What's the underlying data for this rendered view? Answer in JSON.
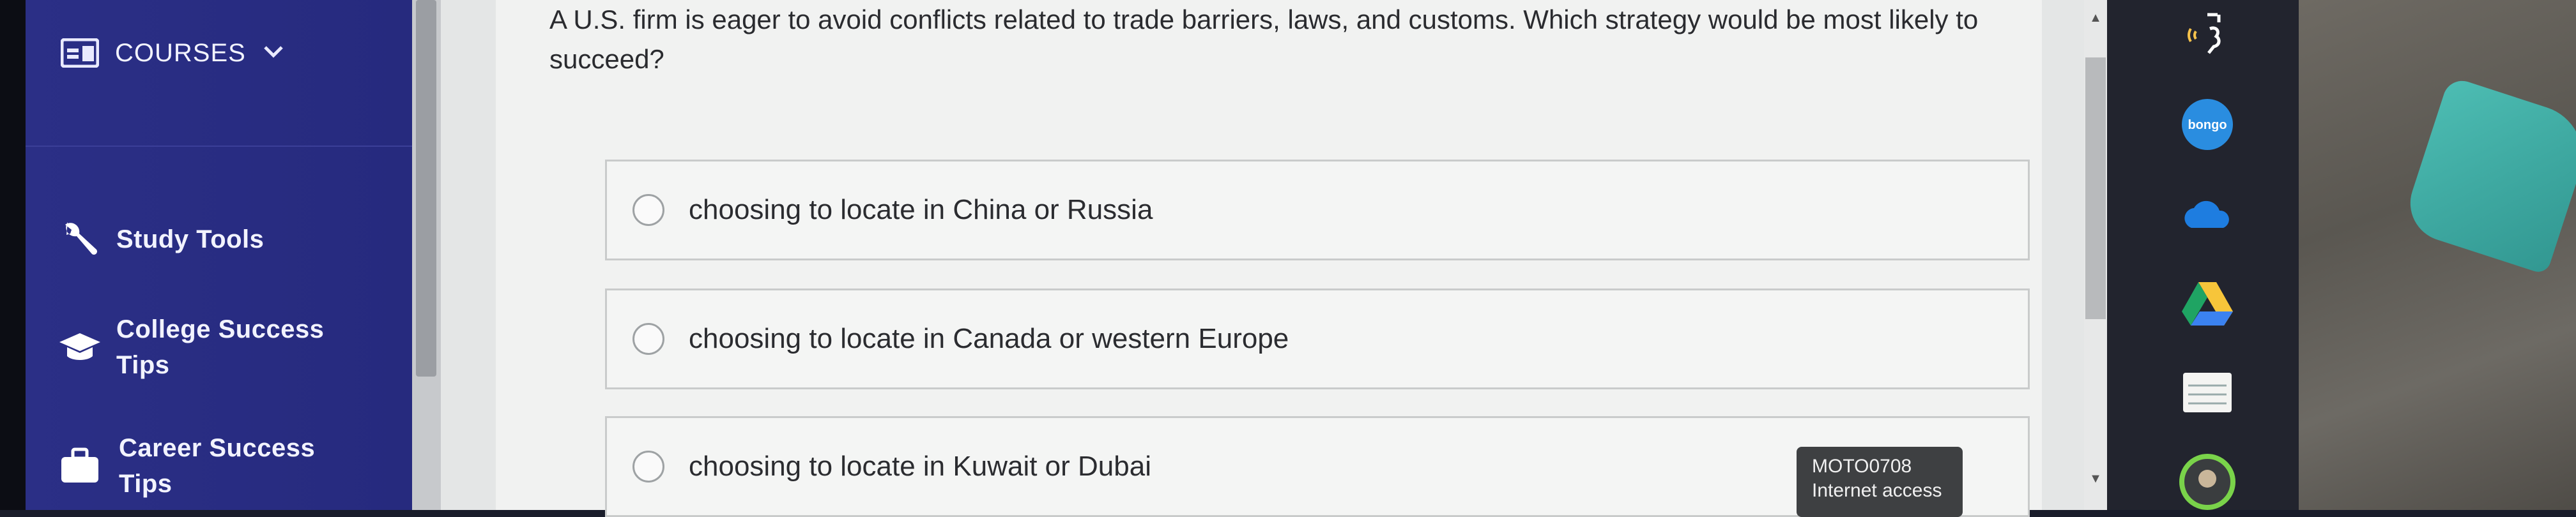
{
  "sidebar": {
    "courses_label": "COURSES",
    "items": [
      {
        "label_line1": "Study Tools",
        "label_line2": ""
      },
      {
        "label_line1": "College Success",
        "label_line2": "Tips"
      },
      {
        "label_line1": "Career Success",
        "label_line2": "Tips"
      }
    ]
  },
  "question": {
    "text": "A U.S. firm is eager to avoid conflicts related to trade barriers, laws, and customs. Which strategy would be most likely to succeed?",
    "options": [
      "choosing to locate in China or Russia",
      "choosing to locate in Canada or western Europe",
      "choosing to locate in Kuwait or Dubai"
    ]
  },
  "tooltip": {
    "line1": "MOTO0708",
    "line2": "Internet access"
  },
  "dock": {
    "icons": [
      "select-to-speak-icon",
      "bongo-icon",
      "onedrive-icon",
      "google-drive-icon",
      "notes-icon",
      "avatar-icon"
    ],
    "bongo_text": "bongo"
  },
  "colors": {
    "sidebar": "#2b2f86",
    "content_bg": "#f1f2f1",
    "text": "#2a2b2f"
  }
}
